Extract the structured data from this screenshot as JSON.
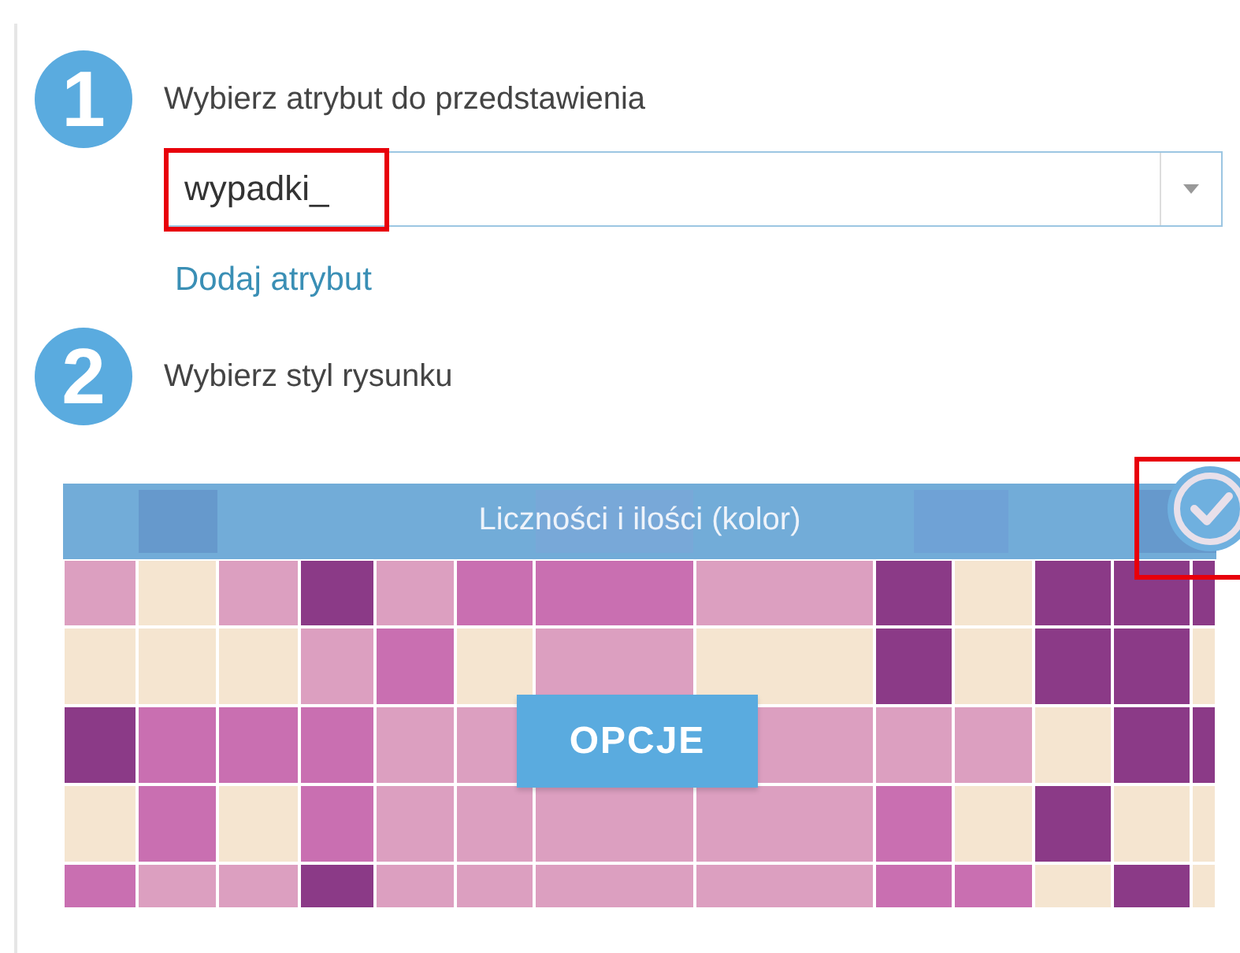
{
  "steps": [
    {
      "number": "1",
      "title": "Wybierz atrybut do przedstawienia"
    },
    {
      "number": "2",
      "title": "Wybierz styl rysunku"
    }
  ],
  "attribute_field": {
    "value": "wypadki_",
    "highlighted": true
  },
  "add_attribute_link": "Dodaj atrybut",
  "style_cards": [
    {
      "label": "Liczności i ilości (kolor)",
      "selected": true,
      "highlighted": true,
      "button": "OPCJE"
    }
  ]
}
